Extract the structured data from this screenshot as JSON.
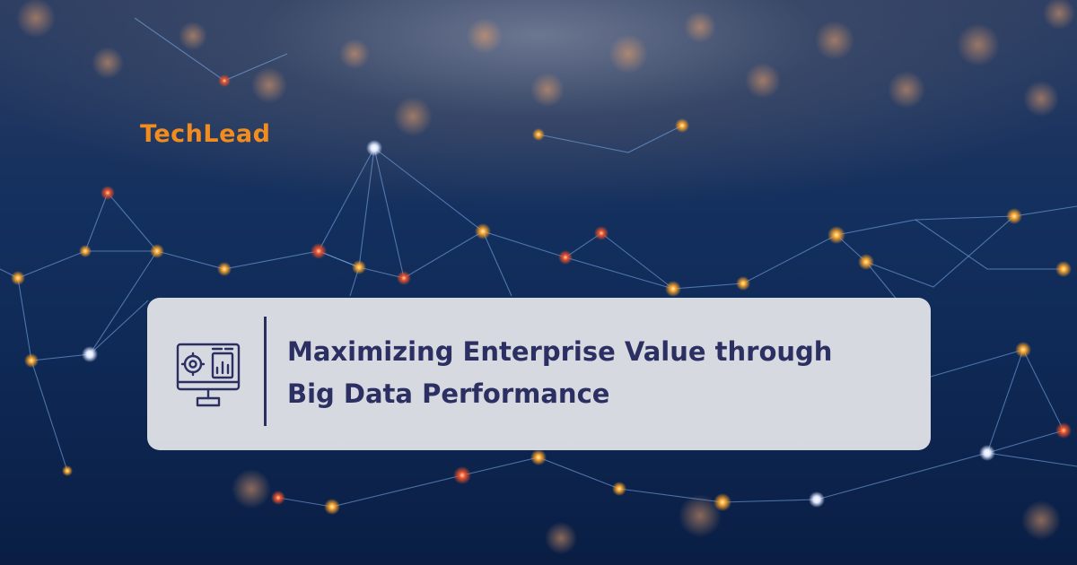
{
  "brand": {
    "logo_text": "TechLead",
    "color": "#f28c1e"
  },
  "headline": {
    "line1": "Maximizing Enterprise Value through",
    "line2": "Big Data Performance",
    "color": "#2b2f62"
  },
  "icon": {
    "name": "monitor-analytics-icon"
  },
  "colors": {
    "background": "#0f2a57",
    "card": "#e2e3e8",
    "node_orange": "#f5a02a",
    "node_red": "#e8502a",
    "link_blue": "#7fb2f0"
  }
}
